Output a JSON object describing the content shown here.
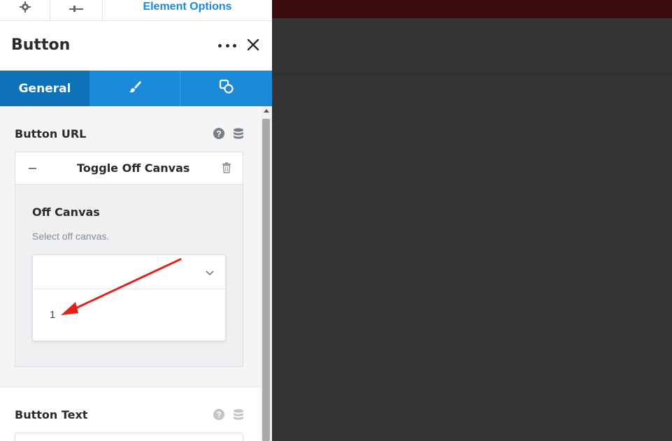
{
  "top_tabs": {
    "settings_icon": "gear-icon",
    "sliders_icon": "sliders-icon",
    "options_label": "Element Options"
  },
  "header": {
    "title": "Button",
    "more_icon": "more-icon",
    "close_icon": "close-icon"
  },
  "section_tabs": {
    "general_label": "General",
    "style_icon": "brush-icon",
    "advanced_icon": "shapes-icon"
  },
  "fields": {
    "button_url": {
      "label": "Button URL",
      "link_type": "Toggle Off Canvas",
      "sub_field_label": "Off Canvas",
      "sub_field_desc": "Select off canvas.",
      "selected_value": "",
      "options": [
        "1"
      ]
    },
    "button_text": {
      "label": "Button Text"
    }
  },
  "colors": {
    "accent": "#1b8ad8",
    "accent_dark": "#0e72b8",
    "annotation_arrow": "#e8201c",
    "canvas_bg": "#333333",
    "canvas_topbar": "#3a0c0c"
  }
}
